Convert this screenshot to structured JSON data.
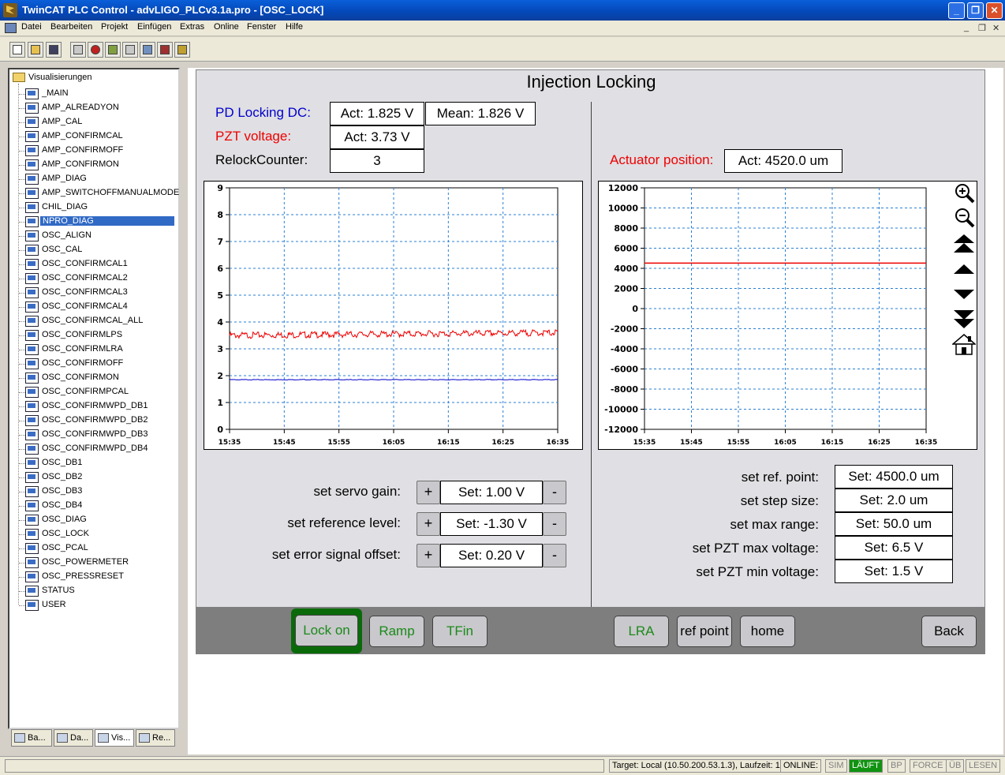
{
  "window": {
    "title": "TwinCAT PLC Control - advLIGO_PLCv3.1a.pro - [OSC_LOCK]"
  },
  "menu": [
    "Datei",
    "Bearbeiten",
    "Projekt",
    "Einfügen",
    "Extras",
    "Online",
    "Fenster",
    "Hilfe"
  ],
  "tree": {
    "root": "Visualisierungen",
    "items": [
      "_MAIN",
      "AMP_ALREADYON",
      "AMP_CAL",
      "AMP_CONFIRMCAL",
      "AMP_CONFIRMOFF",
      "AMP_CONFIRMON",
      "AMP_DIAG",
      "AMP_SWITCHOFFMANUALMODE",
      "CHIL_DIAG",
      "NPRO_DIAG",
      "OSC_ALIGN",
      "OSC_CAL",
      "OSC_CONFIRMCAL1",
      "OSC_CONFIRMCAL2",
      "OSC_CONFIRMCAL3",
      "OSC_CONFIRMCAL4",
      "OSC_CONFIRMCAL_ALL",
      "OSC_CONFIRMLPS",
      "OSC_CONFIRMLRA",
      "OSC_CONFIRMOFF",
      "OSC_CONFIRMON",
      "OSC_CONFIRMPCAL",
      "OSC_CONFIRMWPD_DB1",
      "OSC_CONFIRMWPD_DB2",
      "OSC_CONFIRMWPD_DB3",
      "OSC_CONFIRMWPD_DB4",
      "OSC_DB1",
      "OSC_DB2",
      "OSC_DB3",
      "OSC_DB4",
      "OSC_DIAG",
      "OSC_LOCK",
      "OSC_PCAL",
      "OSC_POWERMETER",
      "OSC_PRESSRESET",
      "STATUS",
      "USER"
    ],
    "selected": "NPRO_DIAG"
  },
  "tabs": [
    "Ba...",
    "Da...",
    "Vis...",
    "Re..."
  ],
  "viz": {
    "title": "Injection Locking",
    "pd_label": "PD Locking DC:",
    "pd_act": "Act: 1.825 V",
    "pd_mean": "Mean: 1.826 V",
    "pzt_label": "PZT voltage:",
    "pzt_act": "Act: 3.73 V",
    "relock_label": "RelockCounter:",
    "relock_value": "3",
    "actuator_label": "Actuator position:",
    "actuator_act": "Act: 4520.0 um",
    "colors": {
      "pd": "#0000cc",
      "pzt": "#ee0000",
      "grid": "#2a7fd4"
    },
    "left_controls": [
      {
        "label": "set servo gain:",
        "value": "Set: 1.00 V"
      },
      {
        "label": "set reference level:",
        "value": "Set: -1.30 V"
      },
      {
        "label": "set error signal offset:",
        "value": "Set: 0.20 V"
      }
    ],
    "plus": "+",
    "minus": "-",
    "right_controls": [
      {
        "label": "set ref. point:",
        "value": "Set: 4500.0 um"
      },
      {
        "label": "set step size:",
        "value": "Set: 2.0 um"
      },
      {
        "label": "set max range:",
        "value": "Set: 50.0 um"
      },
      {
        "label": "set PZT max voltage:",
        "value": "Set: 6.5 V"
      },
      {
        "label": "set PZT min voltage:",
        "value": "Set: 1.5 V"
      }
    ],
    "buttons": {
      "lock_on": "Lock on",
      "ramp": "Ramp",
      "tfin": "TFin",
      "lra": "LRA",
      "ref_point": "ref point",
      "home": "home",
      "back": "Back"
    },
    "zoom_icons": [
      "zoom-in-icon",
      "zoom-out-icon",
      "page-up-icon",
      "up-icon",
      "down-icon",
      "page-down-icon",
      "home-icon"
    ]
  },
  "chart_data": [
    {
      "type": "line",
      "x_ticks": [
        "15:35",
        "15:45",
        "15:55",
        "16:05",
        "16:15",
        "16:25",
        "16:35"
      ],
      "ylim": [
        0,
        9
      ],
      "y_ticks": [
        0,
        1,
        2,
        3,
        4,
        5,
        6,
        7,
        8,
        9
      ],
      "grid": true,
      "series": [
        {
          "color": "#ee0000",
          "x": [
            "15:35",
            "16:35"
          ],
          "values": [
            3.5,
            3.6
          ]
        },
        {
          "color": "#0000cc",
          "x": [
            "15:35",
            "16:35"
          ],
          "values": [
            1.85,
            1.85
          ]
        }
      ]
    },
    {
      "type": "line",
      "x_ticks": [
        "15:35",
        "15:45",
        "15:55",
        "16:05",
        "16:15",
        "16:25",
        "16:35"
      ],
      "ylim": [
        -12000,
        12000
      ],
      "y_ticks": [
        -12000,
        -10000,
        -8000,
        -6000,
        -4000,
        -2000,
        0,
        2000,
        4000,
        6000,
        8000,
        10000,
        12000
      ],
      "grid": true,
      "series": [
        {
          "color": "#ee0000",
          "x": [
            "15:35",
            "16:35"
          ],
          "values": [
            4520,
            4520
          ]
        }
      ]
    }
  ],
  "status": {
    "target": "Target: Local (10.50.200.53.1.3), Laufzeit: 1",
    "online": "ONLINE:",
    "sim": "SIM",
    "laeuft": "LÄUFT",
    "bp": "BP",
    "force": "FORCE",
    "ub": "ÜB",
    "lesen": "LESEN"
  }
}
